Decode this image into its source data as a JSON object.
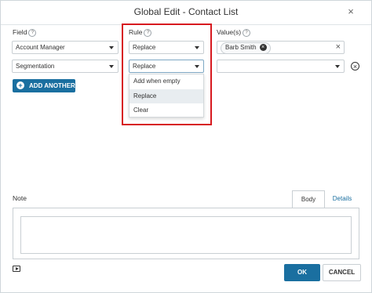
{
  "dialog": {
    "title": "Global Edit - Contact List",
    "close_glyph": "×"
  },
  "columns": {
    "field": "Field",
    "rule": "Rule",
    "values": "Value(s)",
    "help_glyph": "?"
  },
  "rows": [
    {
      "field": "Account Manager",
      "rule": "Replace",
      "value_chip": "Barb Smith",
      "clear_glyph": "×"
    },
    {
      "field": "Segmentation",
      "rule": "Replace",
      "value": "",
      "remove_glyph": "×"
    }
  ],
  "rule_dropdown": {
    "options": [
      "Add when empty",
      "Replace",
      "Clear"
    ],
    "hovered": "Replace"
  },
  "add_another": {
    "label": "ADD ANOTHER",
    "icon_glyph": "+"
  },
  "note": {
    "label": "Note",
    "tabs": [
      "Body",
      "Details"
    ],
    "active_tab": "Body",
    "value": ""
  },
  "footer": {
    "ok_label": "OK",
    "cancel_label": "CANCEL"
  },
  "colors": {
    "primary": "#1a6fa0",
    "highlight": "#d7191f"
  },
  "icons": {
    "preview": "preview-icon"
  }
}
